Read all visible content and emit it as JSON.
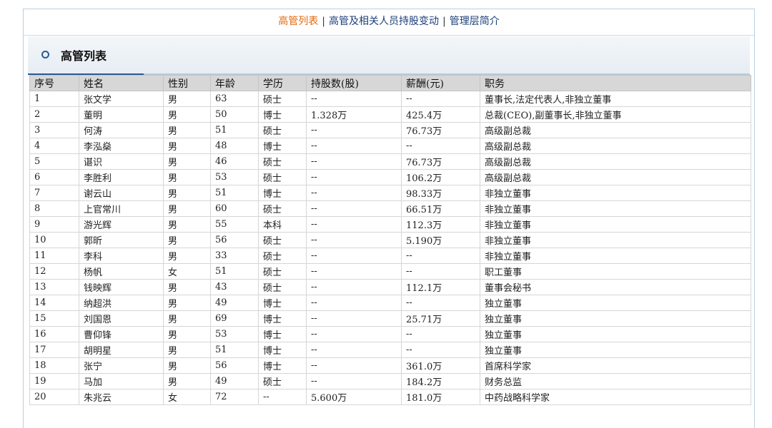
{
  "nav": {
    "items": [
      {
        "label": "高管列表",
        "active": true
      },
      {
        "label": "高管及相关人员持股变动",
        "active": false
      },
      {
        "label": "管理层简介",
        "active": false
      }
    ],
    "separator": "|"
  },
  "section": {
    "title": "高管列表"
  },
  "table": {
    "headers": [
      "序号",
      "姓名",
      "性别",
      "年龄",
      "学历",
      "持股数(股)",
      "薪酬(元)",
      "职务"
    ],
    "rows": [
      [
        "1",
        "张文学",
        "男",
        "63",
        "硕士",
        "--",
        "--",
        "董事长,法定代表人,非独立董事"
      ],
      [
        "2",
        "董明",
        "男",
        "50",
        "博士",
        "1.328万",
        "425.4万",
        "总裁(CEO),副董事长,非独立董事"
      ],
      [
        "3",
        "何涛",
        "男",
        "51",
        "硕士",
        "--",
        "76.73万",
        "高级副总裁"
      ],
      [
        "4",
        "李泓燊",
        "男",
        "48",
        "博士",
        "--",
        "--",
        "高级副总裁"
      ],
      [
        "5",
        "谌识",
        "男",
        "46",
        "硕士",
        "--",
        "76.73万",
        "高级副总裁"
      ],
      [
        "6",
        "李胜利",
        "男",
        "53",
        "硕士",
        "--",
        "106.2万",
        "高级副总裁"
      ],
      [
        "7",
        "谢云山",
        "男",
        "51",
        "博士",
        "--",
        "98.33万",
        "非独立董事"
      ],
      [
        "8",
        "上官常川",
        "男",
        "60",
        "硕士",
        "--",
        "66.51万",
        "非独立董事"
      ],
      [
        "9",
        "游光辉",
        "男",
        "55",
        "本科",
        "--",
        "112.3万",
        "非独立董事"
      ],
      [
        "10",
        "郭昕",
        "男",
        "56",
        "硕士",
        "--",
        "5.190万",
        "非独立董事"
      ],
      [
        "11",
        "李科",
        "男",
        "33",
        "硕士",
        "--",
        "--",
        "非独立董事"
      ],
      [
        "12",
        "杨帆",
        "女",
        "51",
        "硕士",
        "--",
        "--",
        "职工董事"
      ],
      [
        "13",
        "钱映辉",
        "男",
        "43",
        "硕士",
        "--",
        "112.1万",
        "董事会秘书"
      ],
      [
        "14",
        "纳超洪",
        "男",
        "49",
        "博士",
        "--",
        "--",
        "独立董事"
      ],
      [
        "15",
        "刘国恩",
        "男",
        "69",
        "博士",
        "--",
        "25.71万",
        "独立董事"
      ],
      [
        "16",
        "曹仰锋",
        "男",
        "53",
        "博士",
        "--",
        "--",
        "独立董事"
      ],
      [
        "17",
        "胡明星",
        "男",
        "51",
        "博士",
        "--",
        "--",
        "独立董事"
      ],
      [
        "18",
        "张宁",
        "男",
        "56",
        "博士",
        "--",
        "361.0万",
        "首席科学家"
      ],
      [
        "19",
        "马加",
        "男",
        "49",
        "硕士",
        "--",
        "184.2万",
        "财务总监"
      ],
      [
        "20",
        "朱兆云",
        "女",
        "72",
        "--",
        "5.600万",
        "181.0万",
        "中药战略科学家"
      ]
    ]
  },
  "colors": {
    "accent": "#e06a10",
    "link": "#1c3f7a",
    "header_bg": "#d7d7d7",
    "rule": "#2a5b94"
  }
}
